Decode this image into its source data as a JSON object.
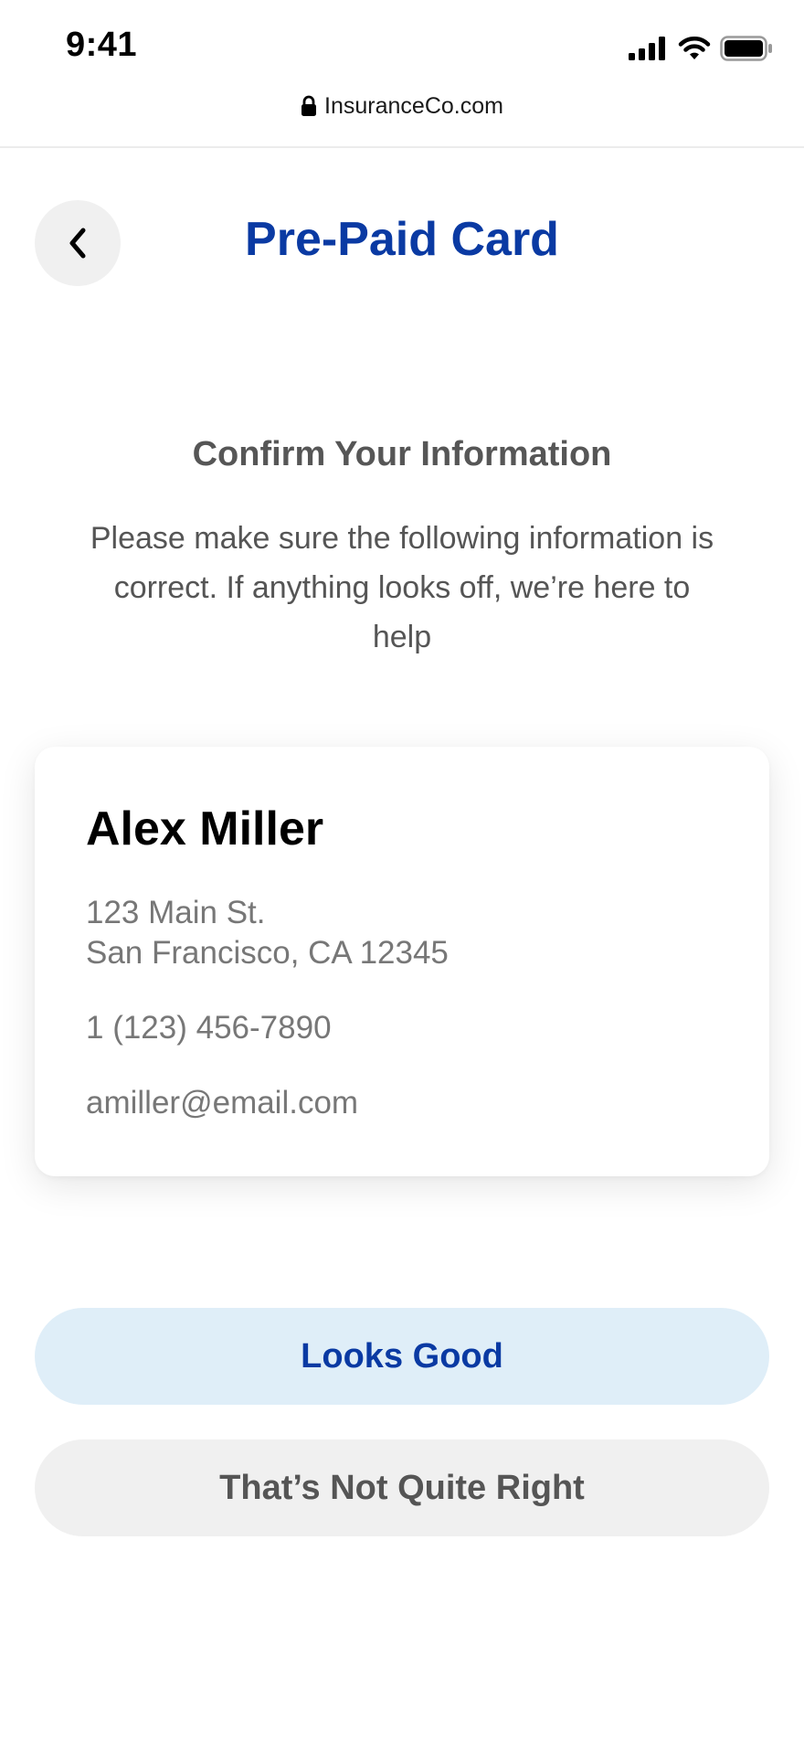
{
  "status_bar": {
    "time": "9:41"
  },
  "browser": {
    "url": "InsuranceCo.com"
  },
  "header": {
    "title": "Pre-Paid Card"
  },
  "confirm": {
    "title": "Confirm Your Information",
    "description": "Please make sure the following information is correct. If anything looks off, we’re here to help"
  },
  "card": {
    "name": "Alex Miller",
    "address_line1": "123 Main St.",
    "address_line2": "San Francisco, CA 12345",
    "phone": "1 (123) 456-7890",
    "email": "amiller@email.com"
  },
  "actions": {
    "confirm_label": "Looks Good",
    "reject_label": "That’s Not Quite Right"
  },
  "colors": {
    "brand_blue": "#0a3aa3",
    "primary_button_bg": "#dfeef8",
    "secondary_button_bg": "#f0f0f0"
  },
  "icons": {
    "signal": "signal-icon",
    "wifi": "wifi-icon",
    "battery": "battery-icon",
    "lock": "lock-icon",
    "back": "chevron-left-icon"
  }
}
